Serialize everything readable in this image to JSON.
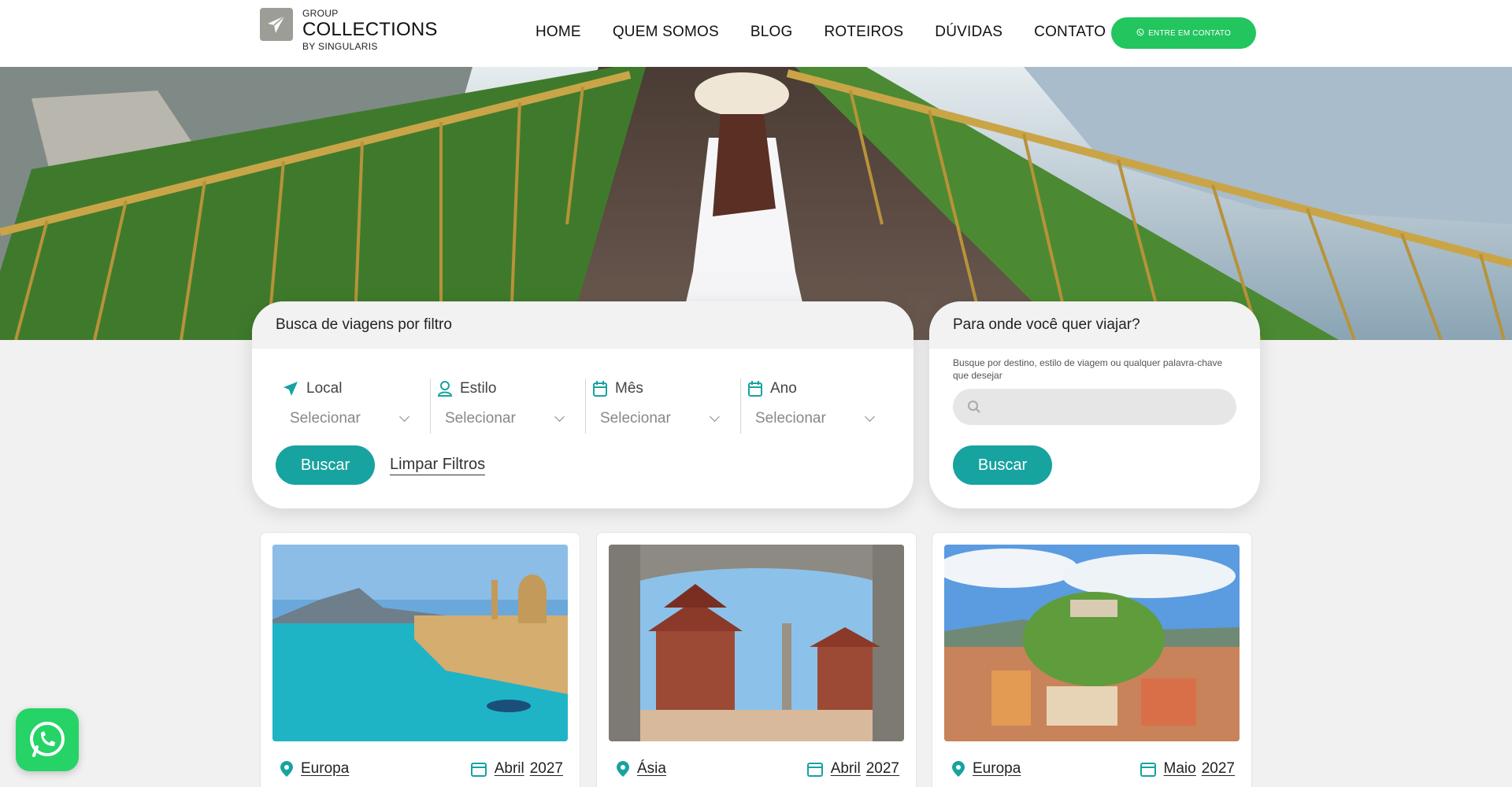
{
  "header": {
    "logo_top": "GROUP",
    "logo_main": "COLLECTIONS",
    "logo_bottom": "BY SINGULARIS",
    "nav": [
      "HOME",
      "QUEM SOMOS",
      "BLOG",
      "ROTEIROS",
      "DÚVIDAS",
      "CONTATO"
    ],
    "cta_label": "ENTRE EM CONTATO"
  },
  "filter_panel": {
    "title": "Busca de viagens por filtro",
    "filters": [
      {
        "label": "Local",
        "value": "Selecionar",
        "icon": "send-icon"
      },
      {
        "label": "Estilo",
        "value": "Selecionar",
        "icon": "user-icon"
      },
      {
        "label": "Mês",
        "value": "Selecionar",
        "icon": "calendar-icon"
      },
      {
        "label": "Ano",
        "value": "Selecionar",
        "icon": "calendar-icon"
      }
    ],
    "search_button": "Buscar",
    "clear_link": "Limpar Filtros"
  },
  "search_panel": {
    "title": "Para onde  você quer viajar?",
    "hint": "Busque por destino, estilo de viagem ou qualquer palavra-chave que desejar",
    "placeholder": "",
    "search_button": "Buscar"
  },
  "cards": [
    {
      "region": "Europa",
      "month": "Abril",
      "year": "2027"
    },
    {
      "region": "Ásia",
      "month": "Abril",
      "year": "2027"
    },
    {
      "region": "Europa",
      "month": "Maio",
      "year": "2027"
    }
  ],
  "colors": {
    "accent": "#17a3a0",
    "cta_green": "#22c55e",
    "whatsapp": "#25d366"
  }
}
